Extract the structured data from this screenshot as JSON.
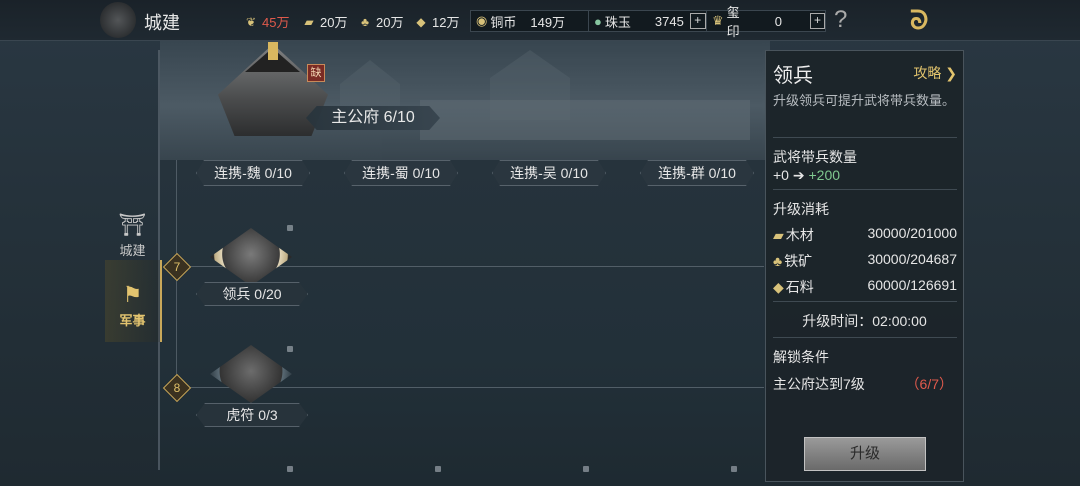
{
  "header": {
    "title": "城建",
    "resources": [
      {
        "icon": "grain-icon",
        "value": "45万",
        "alert": true
      },
      {
        "icon": "wood-icon",
        "value": "20万",
        "alert": false
      },
      {
        "icon": "iron-icon",
        "value": "20万",
        "alert": false
      },
      {
        "icon": "stone-icon",
        "value": "12万",
        "alert": false
      }
    ],
    "copper": {
      "label": "铜币",
      "value": "149万"
    },
    "jade": {
      "label": "珠玉",
      "value": "3745"
    },
    "seal": {
      "label": "玺印",
      "value": "0"
    },
    "help": "?"
  },
  "nav": {
    "city_label": "城建",
    "military_label": "军事"
  },
  "main_hall": {
    "badge": "缺",
    "label": "主公府 6/10"
  },
  "alliances": [
    "连携-魏 0/10",
    "连携-蜀 0/10",
    "连携-吴 0/10",
    "连携-群 0/10"
  ],
  "nodes": [
    {
      "level": "7",
      "label": "领兵 0/20"
    },
    {
      "level": "8",
      "label": "虎符 0/3"
    }
  ],
  "panel": {
    "title": "领兵",
    "guide": "攻略",
    "description": "升级领兵可提升武将带兵数量。",
    "troop_heading": "武将带兵数量",
    "troop_from": "+0",
    "troop_to": "+200",
    "cost_heading": "升级消耗",
    "costs": [
      {
        "icon": "wood-icon",
        "label": "木材",
        "value": "30000/201000"
      },
      {
        "icon": "iron-icon",
        "label": "铁矿",
        "value": "30000/204687"
      },
      {
        "icon": "stone-icon",
        "label": "石料",
        "value": "60000/126691"
      }
    ],
    "time_label": "升级时间：02:00:00",
    "unlock_heading": "解锁条件",
    "unlock_condition": "主公府达到7级",
    "unlock_progress": "（6/7）",
    "upgrade_button": "升级"
  },
  "colors": {
    "accent_gold": "#d9b860",
    "alert_red": "#e05a4c",
    "gain_green": "#7fc88f"
  }
}
